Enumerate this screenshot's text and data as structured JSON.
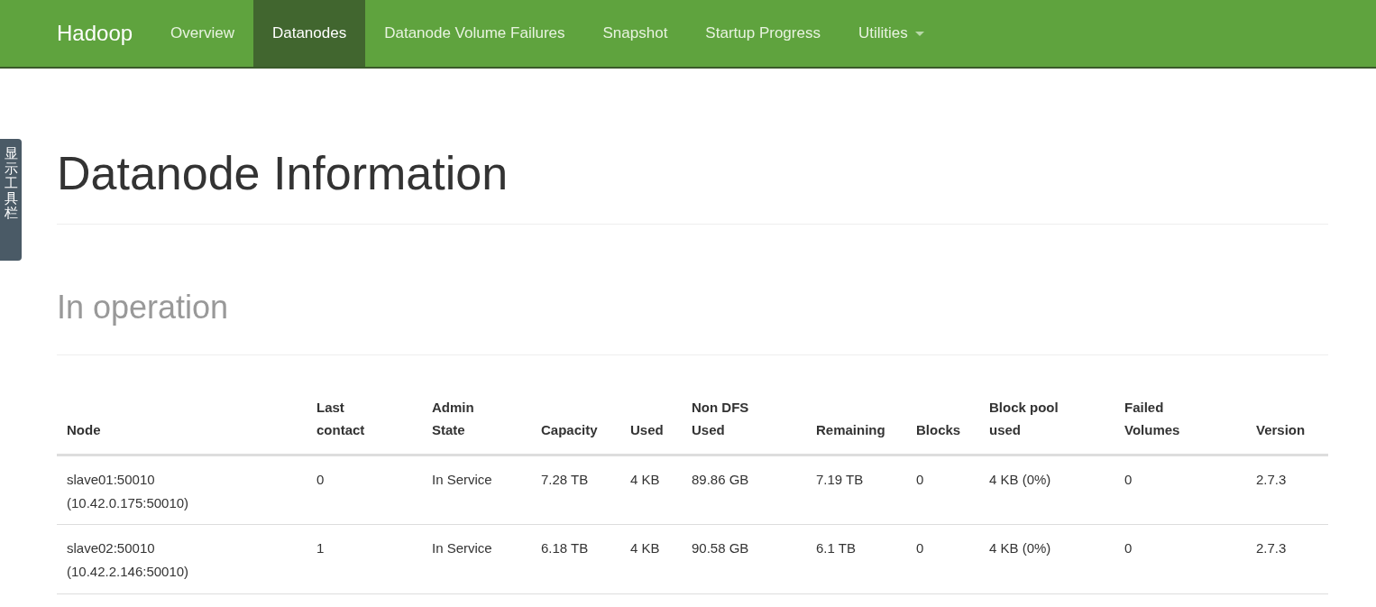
{
  "navbar": {
    "brand": "Hadoop",
    "items": [
      {
        "label": "Overview",
        "selected": false,
        "dropdown": false
      },
      {
        "label": "Datanodes",
        "selected": true,
        "dropdown": false
      },
      {
        "label": "Datanode Volume Failures",
        "selected": false,
        "dropdown": false
      },
      {
        "label": "Snapshot",
        "selected": false,
        "dropdown": false
      },
      {
        "label": "Startup Progress",
        "selected": false,
        "dropdown": false
      },
      {
        "label": "Utilities",
        "selected": false,
        "dropdown": true
      }
    ]
  },
  "side_toolbar": {
    "label": "显示工具栏"
  },
  "page_title": "Datanode Information",
  "section_title": "In operation",
  "table": {
    "columns": [
      "Node",
      "Last contact",
      "Admin State",
      "Capacity",
      "Used",
      "Non DFS Used",
      "Remaining",
      "Blocks",
      "Block pool used",
      "Failed Volumes",
      "Version"
    ],
    "rows": [
      [
        "slave01:50010 (10.42.0.175:50010)",
        "0",
        "In Service",
        "7.28 TB",
        "4 KB",
        "89.86 GB",
        "7.19 TB",
        "0",
        "4 KB (0%)",
        "0",
        "2.7.3"
      ],
      [
        "slave02:50010 (10.42.2.146:50010)",
        "1",
        "In Service",
        "6.18 TB",
        "4 KB",
        "90.58 GB",
        "6.1 TB",
        "0",
        "4 KB (0%)",
        "0",
        "2.7.3"
      ]
    ]
  }
}
